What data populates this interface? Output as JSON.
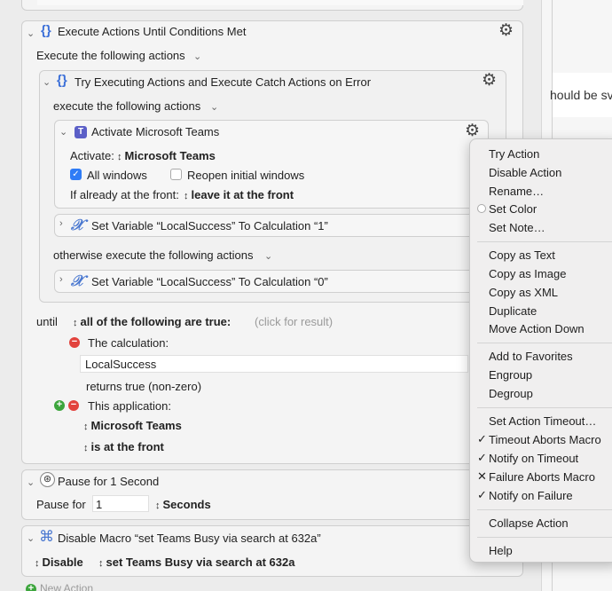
{
  "execute_until": {
    "title": "Execute Actions Until Conditions Met",
    "subtitle": "Execute the following actions"
  },
  "try_block": {
    "title": "Try Executing Actions and Execute Catch Actions on Error",
    "subtitle": "execute the following actions",
    "otherwise": "otherwise execute the following actions"
  },
  "activate": {
    "title": "Activate Microsoft Teams",
    "activate_label": "Activate:",
    "app_value": "Microsoft Teams",
    "all_windows_label": "All windows",
    "all_windows_checked": true,
    "reopen_label": "Reopen initial windows",
    "reopen_checked": false,
    "front_label": "If already at the front:",
    "front_value": "leave it at the front"
  },
  "set_var_1": {
    "title": "Set Variable “LocalSuccess” To Calculation “1”"
  },
  "set_var_0": {
    "title": "Set Variable “LocalSuccess” To Calculation “0”"
  },
  "until": {
    "label": "until",
    "condition": "all of the following are true:",
    "hint": "(click for result)",
    "calc_label": "The calculation:",
    "calc_value": "LocalSuccess",
    "returns": "returns true (non-zero)",
    "app_label": "This application:",
    "app_value": "Microsoft Teams",
    "app_state": "is at the front"
  },
  "pause": {
    "title": "Pause for 1 Second",
    "label": "Pause for",
    "value": "1",
    "unit": "Seconds"
  },
  "disable_macro": {
    "title": "Disable Macro “set Teams Busy via search at 632a”",
    "mode": "Disable",
    "macro": "set Teams Busy via search at 632a"
  },
  "new_action": "New Action",
  "right_panel": {
    "text": "hould be sv"
  },
  "context_menu": {
    "items": [
      "Try Action",
      "Disable Action",
      "Rename…",
      "Set Color",
      "Set Note…",
      "Copy as Text",
      "Copy as Image",
      "Copy as XML",
      "Duplicate",
      "Move Action Down",
      "Add to Favorites",
      "Engroup",
      "Degroup",
      "Set Action Timeout…",
      "Timeout Aborts Macro",
      "Notify on Timeout",
      "Failure Aborts Macro",
      "Notify on Failure",
      "Collapse Action",
      "Help"
    ]
  }
}
